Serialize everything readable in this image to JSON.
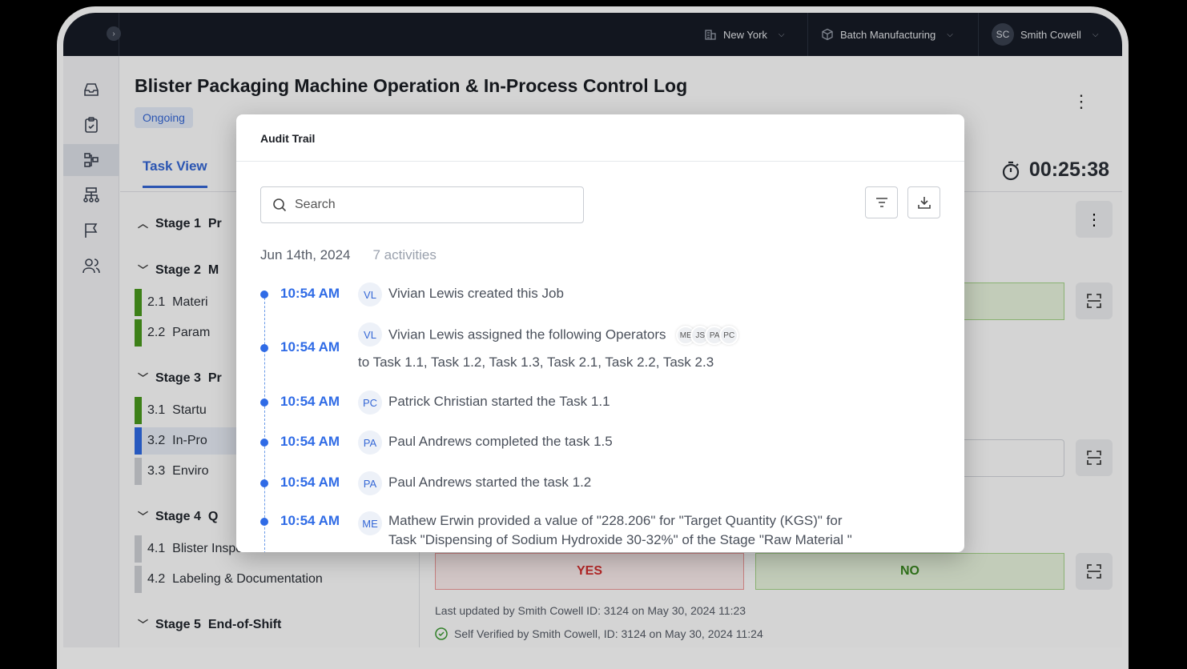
{
  "topbar": {
    "location": "New York",
    "facility": "Batch Manufacturing",
    "user_initials": "SC",
    "user_name": "Smith Cowell"
  },
  "page": {
    "title": "Blister Packaging Machine Operation & In-Process Control Log",
    "status": "Ongoing",
    "tab_task_view": "Task View",
    "timer": "00:25:38"
  },
  "stages": [
    {
      "label": "Stage 1",
      "name": "Pr"
    },
    {
      "label": "Stage 2",
      "name": "M"
    },
    {
      "label": "Stage 3",
      "name": "Pr"
    },
    {
      "label": "Stage 4",
      "name": "Q"
    },
    {
      "label": "Stage 5",
      "name": "End-of-Shift"
    }
  ],
  "tasks": [
    {
      "num": "2.1",
      "name": "Materi"
    },
    {
      "num": "2.2",
      "name": "Param"
    },
    {
      "num": "3.1",
      "name": "Startu"
    },
    {
      "num": "3.2",
      "name": "In-Pro"
    },
    {
      "num": "3.3",
      "name": "Enviro"
    },
    {
      "num": "4.1",
      "name": "Blister Inspection"
    },
    {
      "num": "4.2",
      "name": "Labeling & Documentation"
    }
  ],
  "main": {
    "yes_label": "YES",
    "no_label": "NO",
    "last_updated": "Last updated by Smith Cowell ID: 3124 on May 30, 2024 11:23",
    "self_verified": "Self Verified by Smith Cowell, ID: 3124 on May 30, 2024 11:24"
  },
  "modal": {
    "title": "Audit Trail",
    "search_placeholder": "Search",
    "date": "Jun 14th, 2024",
    "activity_count": "7 activities",
    "entries": [
      {
        "time": "10:54 AM",
        "initials": "VL",
        "text": "Vivian Lewis  created this Job"
      },
      {
        "time": "10:54 AM",
        "initials": "VL",
        "text": "Vivian Lewis  assigned the following Operators",
        "text2": "to Task 1.1, Task 1.2, Task 1.3,  Task 2.1, Task 2.2, Task 2.3",
        "operators": [
          "ME",
          "JS",
          "PA",
          "PC"
        ]
      },
      {
        "time": "10:54 AM",
        "initials": "PC",
        "text": "Patrick Christian  started the Task 1.1"
      },
      {
        "time": "10:54 AM",
        "initials": "PA",
        "text": "Paul Andrews completed the task 1.5"
      },
      {
        "time": "10:54 AM",
        "initials": "PA",
        "text": "Paul Andrews started the task 1.2"
      },
      {
        "time": "10:54 AM",
        "initials": "ME",
        "text": "Mathew Erwin provided a value of \"228.206\" for \"Target Quantity (KGS)\" for",
        "text2": "Task \"Dispensing of Sodium Hydroxide 30-32%\" of the Stage \"Raw Material \""
      }
    ]
  },
  "colors": {
    "accent": "#3467d6",
    "topbar_bg": "#161b26",
    "success": "#3a8a20",
    "danger": "#d83030"
  }
}
